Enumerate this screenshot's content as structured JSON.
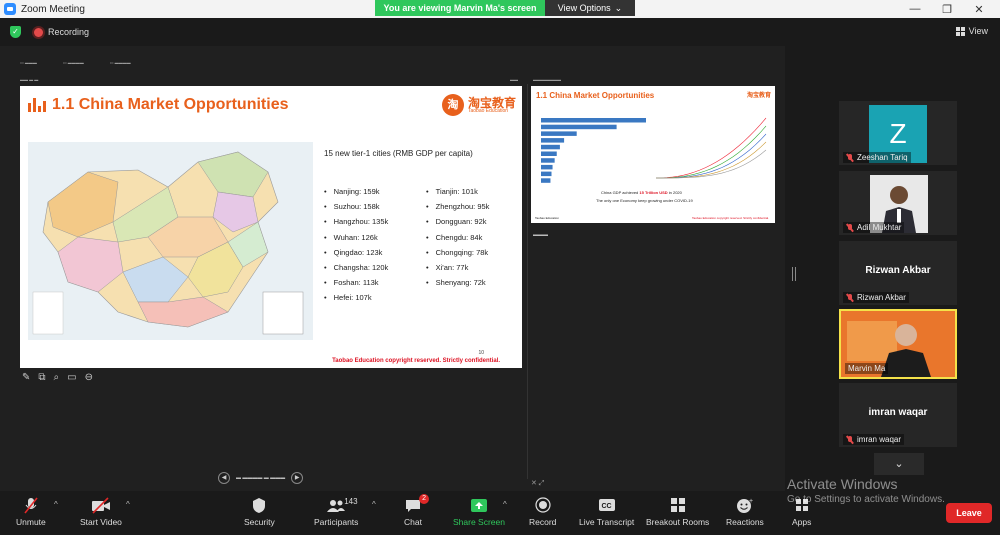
{
  "window": {
    "title": "Zoom Meeting"
  },
  "banner": {
    "viewing_text": "You are viewing Marvin Ma's screen",
    "view_options": "View Options"
  },
  "topbar": {
    "recording": "Recording",
    "view": "View"
  },
  "slide": {
    "title": "1.1 China Market Opportunities",
    "logo_cn": "淘宝教育",
    "logo_en": "Taobao Education",
    "subheading": "15 new tier-1 cities (RMB GDP per capita)",
    "cities_left": [
      "Nanjing: 159k",
      "Suzhou: 158k",
      "Hangzhou: 135k",
      "Wuhan: 126k",
      "Qingdao: 123k",
      "Changsha: 120k",
      "Foshan: 113k",
      "Hefei: 107k"
    ],
    "cities_right": [
      "Tianjin: 101k",
      "Zhengzhou: 95k",
      "Dongguan: 92k",
      "Chengdu: 84k",
      "Chongqing: 78k",
      "Xi'an: 77k",
      "Shenyang: 72k"
    ],
    "footer": "Taobao Education copyright reserved. Strictly confidential.",
    "page_number": "10"
  },
  "preview": {
    "title": "1.1 China Market Opportunities",
    "logo": "淘宝教育",
    "caption1_pre": "China GDP achieved ",
    "caption1_hl": "15 Trillion USD",
    "caption1_post": " in 2020",
    "caption2": "The only one Economy keep growing under COVID-19",
    "footer_left": "Taobao Education",
    "footer_right": "Taobao Education copyright reserved. Strictly confidential.",
    "bar_values": [
      100,
      72,
      34,
      22,
      18,
      15,
      13,
      11,
      10,
      9
    ]
  },
  "participants": [
    {
      "name": "Zeeshan Tariq",
      "avatar_letter": "Z",
      "avatar_color": "#1aa3b3"
    },
    {
      "name": "Adil Mukhtar"
    },
    {
      "name": "Rizwan Akbar",
      "display": "Rizwan Akbar"
    },
    {
      "name": "Marvin Ma"
    },
    {
      "name": "imran waqar",
      "display": "imran waqar"
    }
  ],
  "toolbar": {
    "unmute": "Unmute",
    "start_video": "Start Video",
    "security": "Security",
    "participants": "Participants",
    "participants_count": "143",
    "chat": "Chat",
    "chat_badge": "2",
    "share_screen": "Share Screen",
    "record": "Record",
    "live_transcript": "Live Transcript",
    "breakout_rooms": "Breakout Rooms",
    "reactions": "Reactions",
    "apps": "Apps",
    "leave": "Leave"
  },
  "watermark": {
    "line1": "Activate Windows",
    "line2": "Go to Settings to activate Windows."
  },
  "colors": {
    "accent": "#e8601c",
    "green": "#2fc75c",
    "leave": "#e02828",
    "highlight_frame": "#f4e24a"
  }
}
